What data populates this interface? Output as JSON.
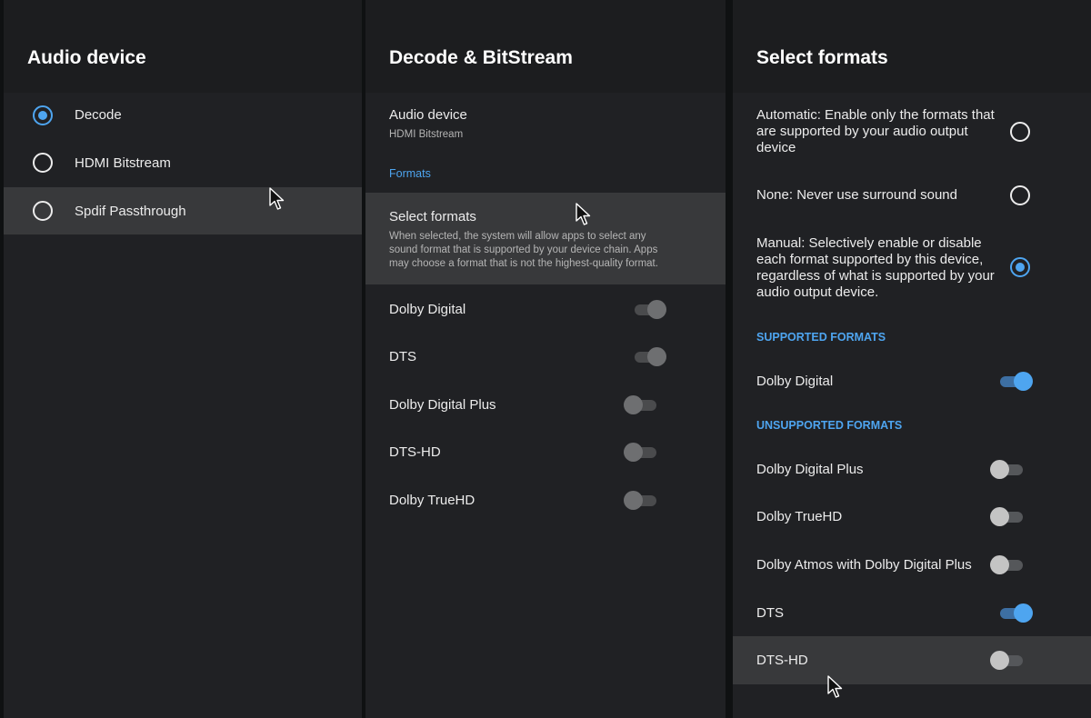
{
  "panel_audio_device": {
    "title": "Audio device",
    "options": [
      {
        "label": "Decode",
        "selected": true
      },
      {
        "label": "HDMI Bitstream",
        "selected": false
      },
      {
        "label": "Spdif Passthrough",
        "selected": false
      }
    ]
  },
  "panel_decode": {
    "title": "Decode & BitStream",
    "audio_device_label": "Audio device",
    "audio_device_value": "HDMI Bitstream",
    "formats_section": "Formats",
    "select_formats_label": "Select formats",
    "select_formats_desc": "When selected, the system will allow apps to select any sound format that is supported by your device chain. Apps may choose a format that is not the highest-quality format.",
    "formats": [
      {
        "label": "Dolby Digital",
        "enabled": true
      },
      {
        "label": "DTS",
        "enabled": true
      },
      {
        "label": "Dolby Digital Plus",
        "enabled": false
      },
      {
        "label": "DTS-HD",
        "enabled": false
      },
      {
        "label": "Dolby TrueHD",
        "enabled": false
      }
    ]
  },
  "panel_select_formats": {
    "title": "Select formats",
    "modes": [
      {
        "label": "Automatic: Enable only the formats that are supported by your audio output device",
        "selected": false
      },
      {
        "label": "None: Never use surround sound",
        "selected": false
      },
      {
        "label": "Manual: Selectively enable or disable each format supported by this device, regardless of what is supported by your audio output device.",
        "selected": true
      }
    ],
    "supported_section": "SUPPORTED FORMATS",
    "supported": [
      {
        "label": "Dolby Digital",
        "enabled": true
      }
    ],
    "unsupported_section": "UNSUPPORTED FORMATS",
    "unsupported": [
      {
        "label": "Dolby Digital Plus",
        "enabled": false
      },
      {
        "label": "Dolby TrueHD",
        "enabled": false
      },
      {
        "label": "Dolby Atmos with Dolby Digital Plus",
        "enabled": false
      },
      {
        "label": "DTS",
        "enabled": true
      },
      {
        "label": "DTS-HD",
        "enabled": false
      }
    ]
  },
  "colors": {
    "accent": "#4ea5f0",
    "panel_bg": "#202124",
    "highlight_bg": "#38393b"
  },
  "icons": {
    "radio": "radio-button-icon",
    "toggle": "toggle-switch-icon",
    "cursor": "mouse-pointer-icon"
  }
}
